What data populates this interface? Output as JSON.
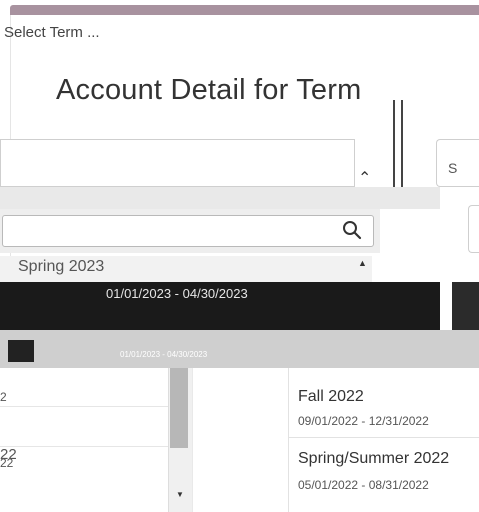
{
  "page": {
    "title": "Account Detail for Term"
  },
  "term_select": {
    "placeholder": "Select Term ...",
    "right_value": "S"
  },
  "search": {
    "value": ""
  },
  "dropdown": {
    "options": [
      {
        "name": "Spring 2023"
      },
      {
        "name": "",
        "dates": "01/01/2023 - 04/30/2023",
        "selected": true
      },
      {
        "name": "",
        "dates": "01/01/2023 - 04/30/2023"
      }
    ]
  },
  "left_list": {
    "rows": [
      {
        "text": "2"
      },
      {
        "text": "22"
      },
      {
        "text": "22"
      }
    ]
  },
  "term_list": {
    "items": [
      {
        "name": "Fall 2022",
        "dates": "09/01/2022 - 12/31/2022"
      },
      {
        "name": "Spring/Summer 2022",
        "dates": "05/01/2022 - 08/31/2022"
      }
    ]
  },
  "colors": {
    "accent_bar": "#a8929f",
    "selected_bg": "#1a1a1a"
  }
}
